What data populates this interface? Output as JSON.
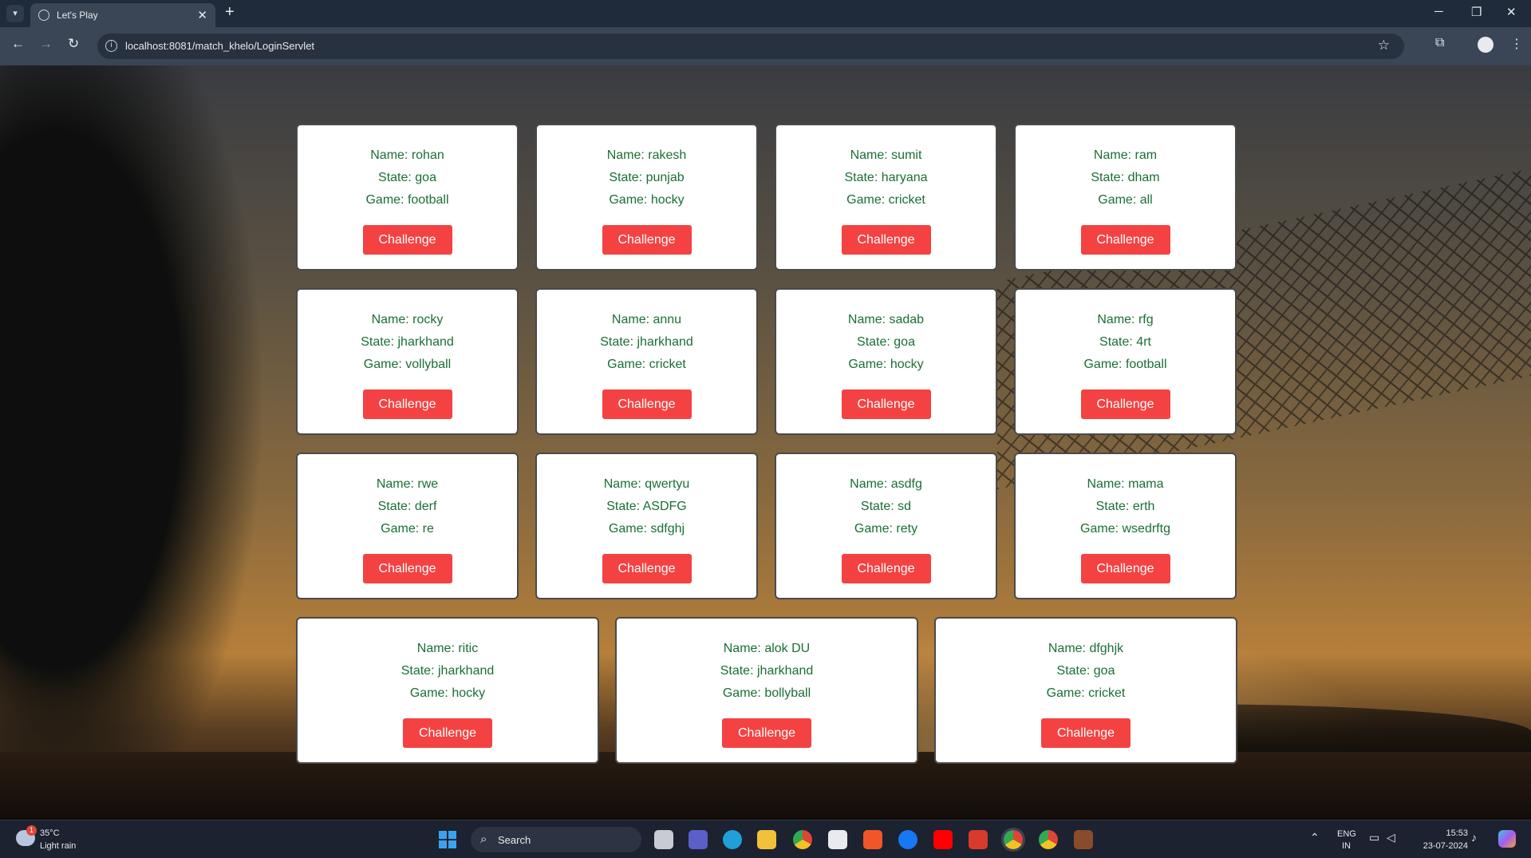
{
  "browser": {
    "tab_title": "Let's Play",
    "url": "localhost:8081/match_khelo/LoginServlet"
  },
  "icons": {
    "tab_menu": "chevron-down-icon",
    "tab_favicon": "globe-icon",
    "new_tab": "plus-icon",
    "back": "arrow-left-icon",
    "forward": "arrow-right-icon",
    "reload": "reload-icon",
    "site_info": "info-icon",
    "bookmark": "star-icon",
    "extensions": "puzzle-icon",
    "profile": "person-icon",
    "menu": "kebab-menu-icon"
  },
  "colors": {
    "card_text": "#1c6e35",
    "button_bg": "#f44242",
    "button_text": "#ffffff",
    "card_bg": "#ffffff"
  },
  "labels": {
    "name_prefix": "Name:",
    "state_prefix": "State:",
    "game_prefix": "Game:",
    "challenge": "Challenge"
  },
  "players": [
    {
      "name": "rohan",
      "state": "goa",
      "game": "football"
    },
    {
      "name": "rakesh",
      "state": "punjab",
      "game": "hocky"
    },
    {
      "name": "sumit",
      "state": "haryana",
      "game": "cricket"
    },
    {
      "name": "ram",
      "state": "dham",
      "game": "all"
    },
    {
      "name": "rocky",
      "state": "jharkhand",
      "game": "vollyball"
    },
    {
      "name": "annu",
      "state": "jharkhand",
      "game": "cricket"
    },
    {
      "name": "sadab",
      "state": "goa",
      "game": "hocky"
    },
    {
      "name": "rfg",
      "state": "4rt",
      "game": "football"
    },
    {
      "name": "rwe",
      "state": "derf",
      "game": "re"
    },
    {
      "name": "qwertyu",
      "state": "ASDFG",
      "game": "sdfghj"
    },
    {
      "name": "asdfg",
      "state": "sd",
      "game": "rety"
    },
    {
      "name": "mama",
      "state": "erth",
      "game": "wsedrftg"
    },
    {
      "name": "ritic",
      "state": "jharkhand",
      "game": "hocky"
    },
    {
      "name": "alok DU",
      "state": "jharkhand",
      "game": "bollyball"
    },
    {
      "name": "dfghjk",
      "state": "goa",
      "game": "cricket"
    }
  ],
  "taskbar": {
    "weather_temp": "35°C",
    "weather_condition": "Light rain",
    "weather_badge": "1",
    "search_label": "Search",
    "lang_line1": "ENG",
    "lang_line2": "IN",
    "time": "15:53",
    "date": "23-07-2024",
    "apps": [
      "file-explorer-icon",
      "meet-icon",
      "edge-icon",
      "folder-icon",
      "chrome-icon",
      "store-icon",
      "brave-icon",
      "facebook-icon",
      "youtube-icon",
      "office-icon",
      "chrome-active-icon",
      "chrome-profile-icon",
      "game-icon"
    ]
  }
}
